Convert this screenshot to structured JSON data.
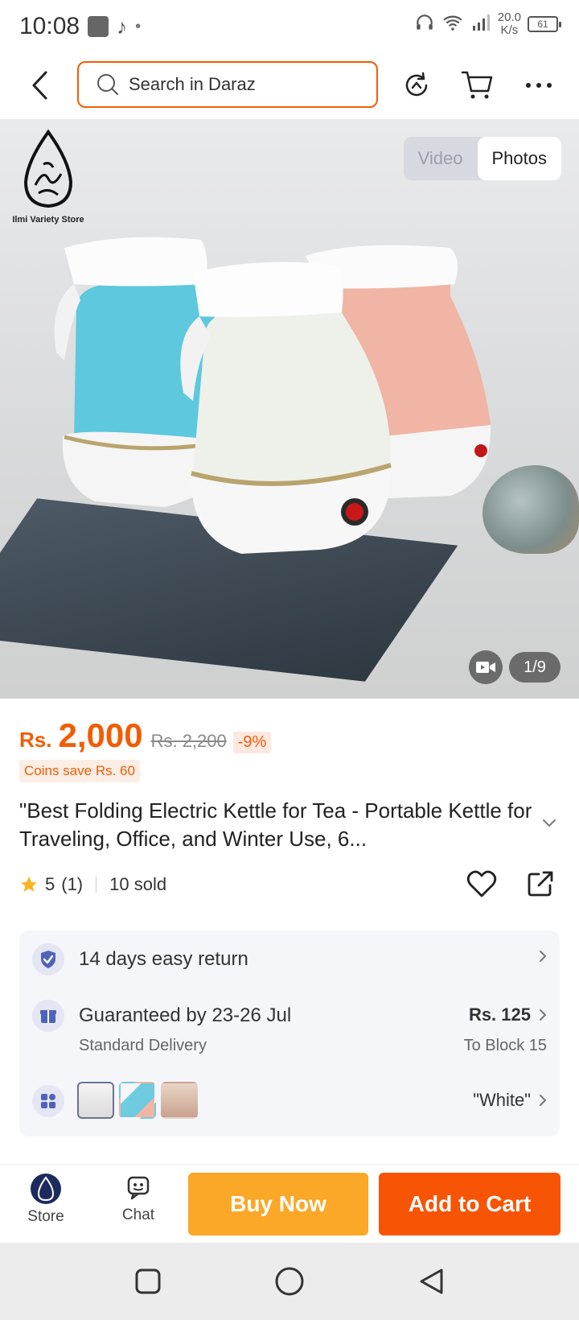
{
  "status": {
    "time": "10:08",
    "netspeed_value": "20.0",
    "netspeed_unit": "K/s",
    "battery": "61"
  },
  "search": {
    "placeholder": "Search in Daraz"
  },
  "store": {
    "name": "Ilmi Variety Store"
  },
  "media_toggle": {
    "video": "Video",
    "photos": "Photos"
  },
  "gallery": {
    "counter": "1/9"
  },
  "product": {
    "currency": "Rs.",
    "price": "2,000",
    "old_price": "Rs. 2,200",
    "discount": "-9%",
    "coins": "Coins save Rs. 60",
    "title": "\"Best Folding Electric Kettle for Tea - Portable Kettle for Traveling, Office, and Winter Use, 6...",
    "rating": "5",
    "rating_count": "(1)",
    "sold": "10 sold"
  },
  "info": {
    "return": "14 days easy return",
    "delivery_title": "Guaranteed by 23-26 Jul",
    "delivery_type": "Standard Delivery",
    "delivery_fee": "Rs. 125",
    "delivery_to": "To Block 15",
    "variant": "\"White\""
  },
  "bottom": {
    "store": "Store",
    "chat": "Chat",
    "buy_now": "Buy Now",
    "add_to_cart": "Add to Cart"
  },
  "colors": {
    "accent": "#f25c05",
    "buy_now": "#fba728",
    "add_to_cart": "#f85406"
  },
  "icons": [
    "back-icon",
    "search-icon",
    "history-icon",
    "cart-icon",
    "more-icon",
    "video-camera-icon",
    "star-icon",
    "heart-icon",
    "share-icon",
    "shield-check-icon",
    "gift-box-icon",
    "grid-icon",
    "chevron-right-icon",
    "chat-icon"
  ]
}
